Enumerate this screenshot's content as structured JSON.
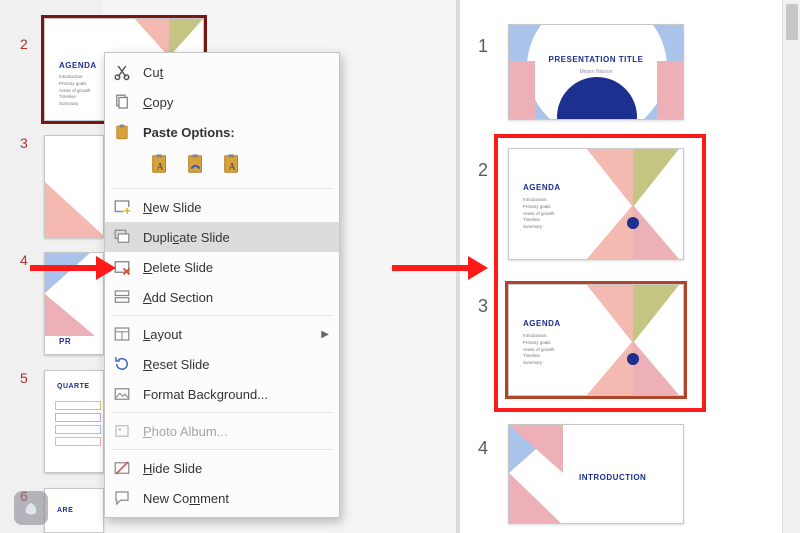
{
  "left_panel": {
    "slides": [
      {
        "num": "2",
        "title": "AGENDA",
        "lines": [
          "Introduction",
          "Primary goals",
          "Areas of growth",
          "Timeline",
          "Summary"
        ],
        "selected": true
      },
      {
        "num": "3",
        "title": "",
        "lines": []
      },
      {
        "num": "4",
        "title_prefix": "PR",
        "lines": []
      },
      {
        "num": "5",
        "title": "QUARTE",
        "lines": []
      },
      {
        "num": "6",
        "title": "ARE",
        "lines": []
      }
    ]
  },
  "context_menu": {
    "cut": "Cut",
    "copy": "Copy",
    "paste_header": "Paste Options:",
    "new_slide": "New Slide",
    "duplicate_slide": "Duplicate Slide",
    "delete_slide": "Delete Slide",
    "add_section": "Add Section",
    "layout": "Layout",
    "reset_slide": "Reset Slide",
    "format_bg": "Format Background...",
    "photo_album": "Photo Album...",
    "hide_slide": "Hide Slide",
    "new_comment": "New Comment",
    "highlighted": "duplicate_slide"
  },
  "right_panel": {
    "slides": [
      {
        "num": "1",
        "title": "PRESENTATION TITLE",
        "sub": "Mirjam Nilsson"
      },
      {
        "num": "2",
        "title": "AGENDA",
        "lines": [
          "Introduction",
          "Primary goals",
          "Areas of growth",
          "Timeline",
          "Summary"
        ]
      },
      {
        "num": "3",
        "title": "AGENDA",
        "lines": [
          "Introduction",
          "Primary goals",
          "Areas of growth",
          "Timeline",
          "Summary"
        ],
        "selected": true
      },
      {
        "num": "4",
        "title": "INTRODUCTION"
      }
    ]
  },
  "colors": {
    "accent": "#1d2f8f",
    "peach": "#f4b9b0",
    "olive": "#c5c583",
    "softblue": "#a9c3eb",
    "softpink": "#edb0b6",
    "red": "#ff1a1a"
  }
}
